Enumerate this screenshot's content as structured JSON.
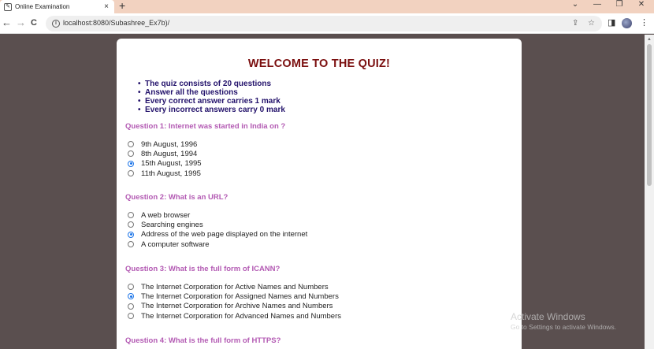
{
  "browser": {
    "tab_title": "Online Examination",
    "tab_close": "×",
    "new_tab": "+",
    "url": "localhost:8080/Subashree_Ex7b)/",
    "window_controls": {
      "chevron": "⌄",
      "minimize": "—",
      "restore": "❐",
      "close": "✕"
    },
    "nav": {
      "back": "←",
      "forward": "→",
      "reload": "C"
    },
    "omnibox_icons": {
      "share": "⇪",
      "star": "☆"
    },
    "toolbar_icons": {
      "sidebar": "◨",
      "menu": "⋮"
    }
  },
  "quiz": {
    "title": "WELCOME TO THE QUIZ!",
    "rules": [
      "The quiz consists of 20 questions",
      "Answer all the questions",
      "Every correct answer carries 1 mark",
      "Every incorrect answers carry 0 mark"
    ],
    "questions": [
      {
        "label": "Question 1: Internet was started in India on ?",
        "options": [
          "9th August, 1996",
          "8th August, 1994",
          "15th August, 1995",
          "11th August, 1995"
        ],
        "selected_index": 2
      },
      {
        "label": "Question 2: What is an URL?",
        "options": [
          "A web browser",
          "Searching engines",
          "Address of the web page displayed on the internet",
          "A computer software"
        ],
        "selected_index": 2
      },
      {
        "label": "Question 3: What is the full form of ICANN?",
        "options": [
          "The Internet Corporation for Active Names and Numbers",
          "The Internet Corporation for Assigned Names and Numbers",
          "The Internet Corporation for Archive Names and Numbers",
          "The Internet Corporation for Advanced Names and Numbers"
        ],
        "selected_index": 1
      },
      {
        "label": "Question 4: What is the full form of HTTPS?",
        "options": [],
        "selected_index": null
      }
    ]
  },
  "watermark": {
    "line1": "Activate Windows",
    "line2": "Go to Settings to activate Windows."
  }
}
